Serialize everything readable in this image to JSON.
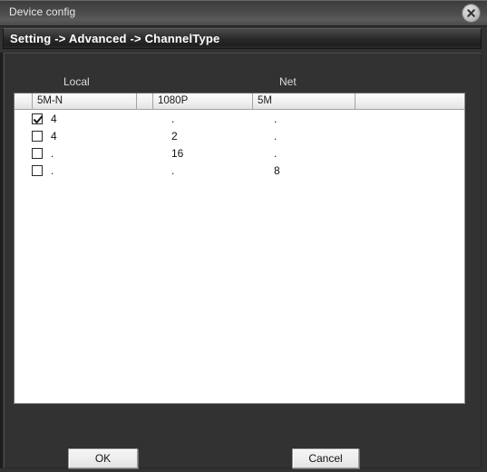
{
  "window": {
    "title": "Device config",
    "close_icon": "close-circle-icon"
  },
  "breadcrumb": {
    "text": "Setting -> Advanced -> ChannelType"
  },
  "groups": {
    "local_label": "Local",
    "net_label": "Net"
  },
  "table": {
    "headers": [
      "",
      "5M-N",
      "",
      "1080P",
      "5M",
      ""
    ],
    "rows": [
      {
        "checked": true,
        "c1": "4",
        "c2": ".",
        "c3": "."
      },
      {
        "checked": false,
        "c1": "4",
        "c2": "2",
        "c3": "."
      },
      {
        "checked": false,
        "c1": ".",
        "c2": "16",
        "c3": "."
      },
      {
        "checked": false,
        "c1": ".",
        "c2": ".",
        "c3": "8"
      }
    ]
  },
  "buttons": {
    "ok": "OK",
    "cancel": "Cancel"
  },
  "colors": {
    "window_bg": "#323232",
    "titlebar": "#4d4d4d",
    "table_bg": "#ffffff",
    "text_light": "#e9e9e9",
    "text_dark": "#111111"
  }
}
